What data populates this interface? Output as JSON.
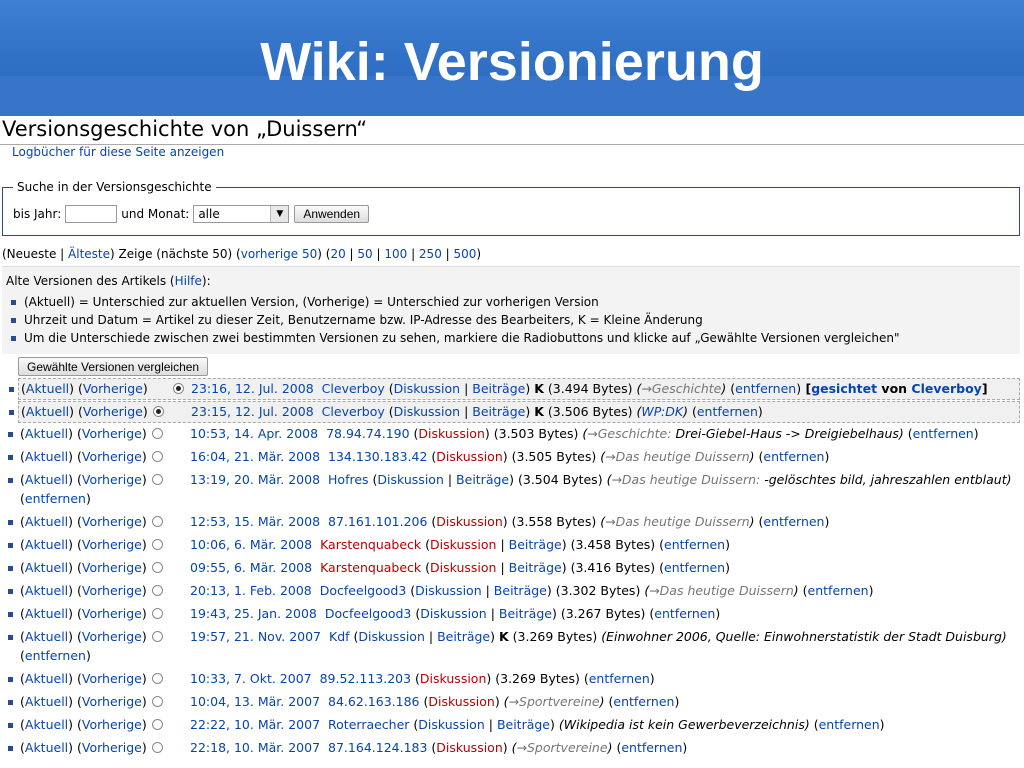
{
  "slide": {
    "title": "Wiki: Versionierung"
  },
  "page": {
    "title": "Versionsgeschichte von „Duissern“",
    "logs_link": "Logbücher für diese Seite anzeigen"
  },
  "search": {
    "legend": "Suche in der Versionsgeschichte",
    "year_label": "bis Jahr:",
    "year_value": "",
    "month_label": "und Monat:",
    "month_value": "alle",
    "submit_label": "Anwenden"
  },
  "nav": {
    "open": "(Neueste | ",
    "oldest": "Älteste",
    "mid": ") Zeige (nächste 50) (",
    "previous": "vorherige 50",
    "mid2": ") (",
    "n20": "20",
    "n50": "50",
    "n100": "100",
    "n250": "250",
    "n500": "500",
    "sep": " | ",
    "close": ")"
  },
  "legend_box": {
    "head_pre": "Alte Versionen des Artikels (",
    "help": "Hilfe",
    "head_post": "):",
    "items": [
      "(Aktuell) = Unterschied zur aktuellen Version, (Vorherige) = Unterschied zur vorherigen Version",
      "Uhrzeit und Datum = Artikel zu dieser Zeit, Benutzername bzw. IP-Adresse des Bearbeiters, K = Kleine Änderung",
      "Um die Unterschiede zwischen zwei bestimmten Versionen zu sehen, markiere die Radiobuttons und klicke auf „Gewählte Versionen vergleichen\""
    ],
    "compare_label": "Gewählte Versionen vergleichen"
  },
  "labels": {
    "aktuell": "Aktuell",
    "vorherige": "Vorherige",
    "diskussion": "Diskussion",
    "beitraege": "Beiträge",
    "entfernen": "entfernen",
    "minor": "K",
    "gesichtet": "gesichtet",
    "von": "von"
  },
  "revisions": [
    {
      "date": "23:16, 12. Jul. 2008",
      "user": "Cleverboy",
      "contrib": true,
      "disk_red": false,
      "minor": true,
      "size": "(3.494 Bytes)",
      "sec": "→Geschichte",
      "comment": "",
      "gesichtet_by": "Cleverboy"
    },
    {
      "date": "23:15, 12. Jul. 2008",
      "user": "Cleverboy",
      "contrib": true,
      "disk_red": false,
      "minor": true,
      "size": "(3.506 Bytes)",
      "sec": "",
      "comment": "WP:DK"
    },
    {
      "date": "10:53, 14. Apr. 2008",
      "user": "78.94.74.190",
      "contrib": false,
      "disk_red": true,
      "minor": false,
      "size": "(3.503 Bytes)",
      "sec": "→Geschichte:",
      "comment": "Drei-Giebel-Haus -> Dreigiebelhaus"
    },
    {
      "date": "16:04, 21. Mär. 2008",
      "user": "134.130.183.42",
      "contrib": false,
      "disk_red": true,
      "minor": false,
      "size": "(3.505 Bytes)",
      "sec": "→Das heutige Duissern",
      "comment": ""
    },
    {
      "date": "13:19, 20. Mär. 2008",
      "user": "Hofres",
      "contrib": true,
      "disk_red": false,
      "minor": false,
      "size": "(3.504 Bytes)",
      "sec": "→Das heutige Duissern:",
      "comment": "-gelöschtes bild, jahreszahlen entblaut",
      "wrap": true
    },
    {
      "date": "12:53, 15. Mär. 2008",
      "user": "87.161.101.206",
      "contrib": false,
      "disk_red": true,
      "minor": false,
      "size": "(3.558 Bytes)",
      "sec": "→Das heutige Duissern",
      "comment": ""
    },
    {
      "date": "10:06, 6. Mär. 2008",
      "user": "Karstenquabeck",
      "user_red": true,
      "contrib": true,
      "disk_red": true,
      "minor": false,
      "size": "(3.458 Bytes)",
      "sec": "",
      "comment": ""
    },
    {
      "date": "09:55, 6. Mär. 2008",
      "user": "Karstenquabeck",
      "user_red": true,
      "contrib": true,
      "disk_red": true,
      "minor": false,
      "size": "(3.416 Bytes)",
      "sec": "",
      "comment": ""
    },
    {
      "date": "20:13, 1. Feb. 2008",
      "user": "Docfeelgood3",
      "contrib": true,
      "disk_red": false,
      "minor": false,
      "size": "(3.302 Bytes)",
      "sec": "→Das heutige Duissern",
      "comment": ""
    },
    {
      "date": "19:43, 25. Jan. 2008",
      "user": "Docfeelgood3",
      "contrib": true,
      "disk_red": false,
      "minor": false,
      "size": "(3.267 Bytes)",
      "sec": "",
      "comment": ""
    },
    {
      "date": "19:57, 21. Nov. 2007",
      "user": "Kdf",
      "contrib": true,
      "disk_red": false,
      "minor": true,
      "size": "(3.269 Bytes)",
      "sec": "",
      "comment": "Einwohner 2006, Quelle: Einwohnerstatistik der Stadt Duisburg",
      "wrap": true
    },
    {
      "date": "10:33, 7. Okt. 2007",
      "user": "89.52.113.203",
      "contrib": false,
      "disk_red": true,
      "minor": false,
      "size": "(3.269 Bytes)",
      "sec": "",
      "comment": ""
    },
    {
      "date": "10:04, 13. Mär. 2007",
      "user": "84.62.163.186",
      "contrib": false,
      "disk_red": true,
      "minor": false,
      "size": "",
      "sec": "→Sportvereine",
      "comment": ""
    },
    {
      "date": "22:22, 10. Mär. 2007",
      "user": "Roterraecher",
      "contrib": true,
      "disk_red": false,
      "minor": false,
      "size": "",
      "sec": "",
      "comment": "Wikipedia ist kein Gewerbeverzeichnis"
    },
    {
      "date": "22:18, 10. Mär. 2007",
      "user": "87.164.124.183",
      "contrib": false,
      "disk_red": true,
      "minor": false,
      "size": "",
      "sec": "→Sportvereine",
      "comment": ""
    }
  ]
}
